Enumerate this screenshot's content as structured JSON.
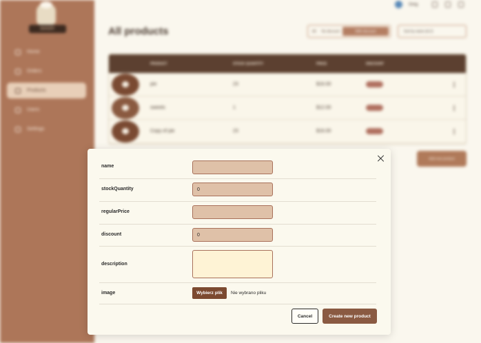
{
  "brand": {
    "logo_text": "BAKERY"
  },
  "sidebar": {
    "items": [
      {
        "label": "Home",
        "active": false
      },
      {
        "label": "Orders",
        "active": false
      },
      {
        "label": "Products",
        "active": true
      },
      {
        "label": "Users",
        "active": false
      },
      {
        "label": "Settings",
        "active": false
      }
    ]
  },
  "topbar": {
    "user_name": "Greg"
  },
  "page": {
    "title": "All products"
  },
  "filters": {
    "all": "All",
    "no_discount": "No discount",
    "with_discount": "With discount"
  },
  "sort": {
    "value": "Sort by name (A-Z)"
  },
  "table": {
    "headers": [
      "PRODUCT",
      "STOCK QUANTITY",
      "PRICE",
      "DISCOUNT"
    ],
    "rows": [
      {
        "name": "pie",
        "stock": "23",
        "price": "$16.00",
        "discount": "20%"
      },
      {
        "name": "sweets",
        "stock": "1",
        "price": "$12.00",
        "discount": "20%"
      },
      {
        "name": "Copy of pie",
        "stock": "23",
        "price": "$16.00",
        "discount": "20%"
      }
    ]
  },
  "add_button": {
    "label": "Add new product"
  },
  "modal": {
    "fields": {
      "name": {
        "label": "name",
        "value": ""
      },
      "stockQuantity": {
        "label": "stockQuantity",
        "value": "0"
      },
      "regularPrice": {
        "label": "regularPrice",
        "value": ""
      },
      "discount": {
        "label": "discount",
        "value": "0"
      },
      "description": {
        "label": "description",
        "value": ""
      },
      "image": {
        "label": "image",
        "button": "Wybierz plik",
        "status": "Nie wybrano pliku"
      }
    },
    "cancel": "Cancel",
    "submit": "Create new product"
  },
  "colors": {
    "sidebar": "#ad7659",
    "accent": "#8a5a42",
    "table_header": "#5c4030",
    "input_bg": "#dfc1a8",
    "page_bg": "#faf7ee"
  }
}
